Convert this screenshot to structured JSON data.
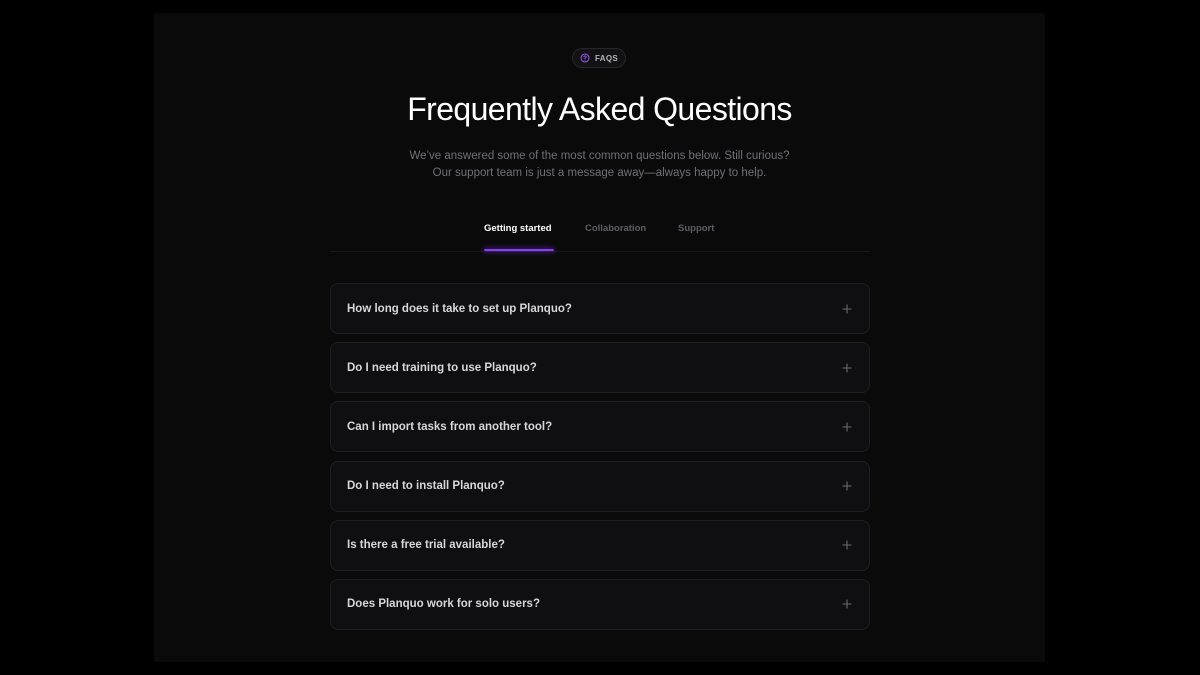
{
  "badge": {
    "label": "FAQS",
    "icon": "question-circle-icon"
  },
  "title": "Frequently Asked Questions",
  "subtitle": {
    "line1": "We’ve answered some of the most common questions below. Still curious?",
    "line2": "Our support team is just a message away—always happy to help."
  },
  "tabs": [
    {
      "label": "Getting started",
      "active": true
    },
    {
      "label": "Collaboration",
      "active": false
    },
    {
      "label": "Support",
      "active": false
    }
  ],
  "faqs": [
    {
      "question": "How long does it take to set up Planquo?"
    },
    {
      "question": "Do I need training to use Planquo?"
    },
    {
      "question": "Can I import tasks from another tool?"
    },
    {
      "question": "Do I need to install Planquo?"
    },
    {
      "question": "Is there a free trial available?"
    },
    {
      "question": "Does Planquo work for solo users?"
    }
  ],
  "colors": {
    "accent": "#8b3cf6",
    "background": "#0a0a0b",
    "card": "#0f0f11"
  }
}
